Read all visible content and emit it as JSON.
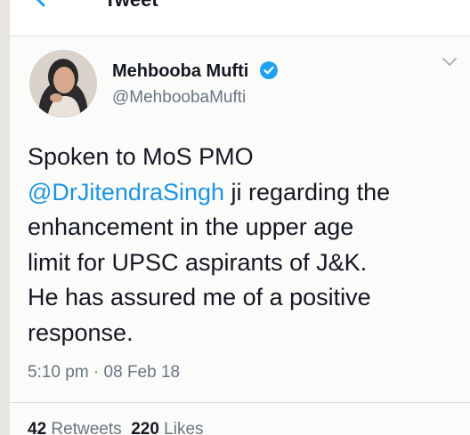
{
  "header": {
    "title": "Tweet",
    "back_icon": "back-arrow-icon"
  },
  "tweet": {
    "author_name": "Mehbooba Mufti",
    "author_handle": "@MehboobaMufti",
    "verified": true,
    "text_line1": "Spoken to MoS PMO",
    "mention": "@DrJitendraSingh",
    "text_after_mention": " ji regarding the",
    "text_line3": "enhancement in the upper age",
    "text_line4": "limit for UPSC aspirants of J&K.",
    "text_line5": "He has assured me of a positive",
    "text_line6": "response.",
    "timestamp": "5:10 pm · 08 Feb 18"
  },
  "stats": {
    "retweets_count": "42",
    "retweets_label": " Retweets",
    "likes_count": "220",
    "likes_label": " Likes"
  },
  "colors": {
    "accent": "#1da1f2",
    "mention": "#1b95e0",
    "secondary_text": "#687682",
    "primary_text": "#141823"
  }
}
